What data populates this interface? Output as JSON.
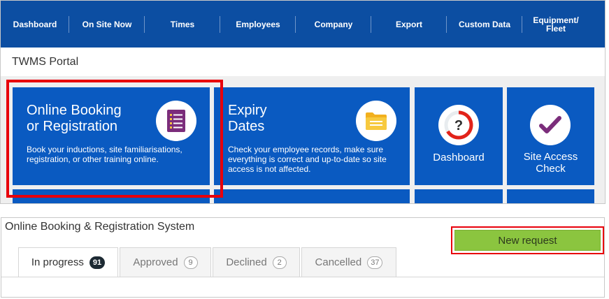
{
  "nav": {
    "items": [
      "Dashboard",
      "On Site Now",
      "Times",
      "Employees",
      "Company",
      "Export",
      "Custom Data",
      "Equipment/ Fleet"
    ]
  },
  "portal": {
    "title": "TWMS Portal"
  },
  "tiles": {
    "online_booking": {
      "title": "Online Booking or Registration",
      "title_line1": "Online Booking",
      "title_line2": "or Registration",
      "description": "Book your inductions, site familiarisations, registration, or other training online."
    },
    "expiry": {
      "title_line1": "Expiry",
      "title_line2": "Dates",
      "description": "Check your employee records, make sure everything is correct and up-to-date so site access is not affected."
    },
    "dashboard": {
      "label": "Dashboard"
    },
    "site_access": {
      "label_line1": "Site Access",
      "label_line2": "Check"
    }
  },
  "booking_system": {
    "title": "Online Booking & Registration System",
    "new_request_label": "New request",
    "tabs": [
      {
        "label": "In progress",
        "count": "91"
      },
      {
        "label": "Approved",
        "count": "9"
      },
      {
        "label": "Declined",
        "count": "2"
      },
      {
        "label": "Cancelled",
        "count": "37"
      }
    ]
  },
  "colors": {
    "nav_bg": "#0c4ea2",
    "tile_bg": "#0a5ac1",
    "highlight": "#e8000b",
    "new_request_bg": "#8bc53f"
  }
}
